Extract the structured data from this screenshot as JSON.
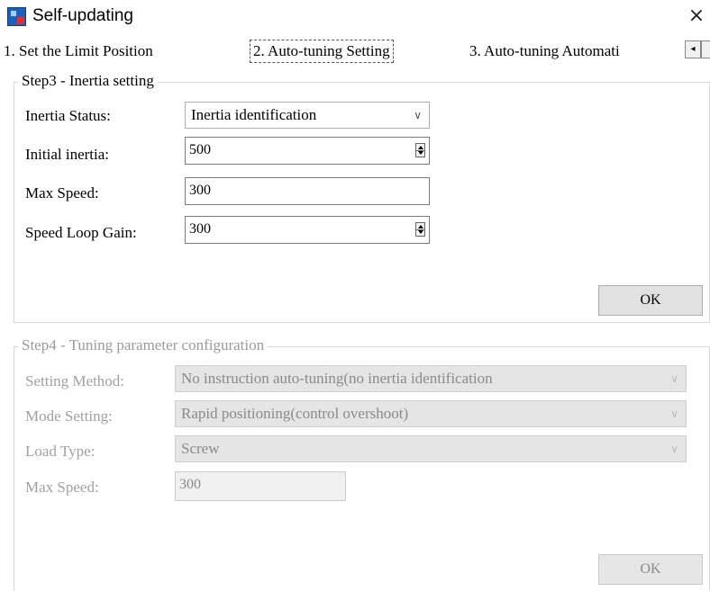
{
  "window": {
    "title": "Self-updating",
    "close_glyph": "×",
    "icon": "app-icon"
  },
  "tabs": [
    {
      "label": "1. Set the Limit Position",
      "selected": false
    },
    {
      "label": "2. Auto-tuning Setting",
      "selected": true
    },
    {
      "label": "3. Auto-tuning Automati",
      "selected": false
    }
  ],
  "tab_scroll_glyph": "◂",
  "step3": {
    "legend": "Step3 - Inertia setting",
    "inertia_status": {
      "label": "Inertia Status:",
      "value": "Inertia identification"
    },
    "initial_inertia": {
      "label": "Initial inertia:",
      "value": "500"
    },
    "max_speed": {
      "label": "Max Speed:",
      "value": "300"
    },
    "speed_loop_gain": {
      "label": "Speed Loop Gain:",
      "value": "300"
    },
    "ok_label": "OK"
  },
  "step4": {
    "legend": "Step4 - Tuning parameter configuration",
    "setting_method": {
      "label": "Setting Method:",
      "value": "No instruction auto-tuning(no inertia identification"
    },
    "mode_setting": {
      "label": "Mode Setting:",
      "value": "Rapid positioning(control overshoot)"
    },
    "load_type": {
      "label": "Load Type:",
      "value": "Screw"
    },
    "max_speed": {
      "label": "Max Speed:",
      "value": "300"
    },
    "ok_label": "OK",
    "disabled": true
  },
  "chevron_glyph": "∨"
}
